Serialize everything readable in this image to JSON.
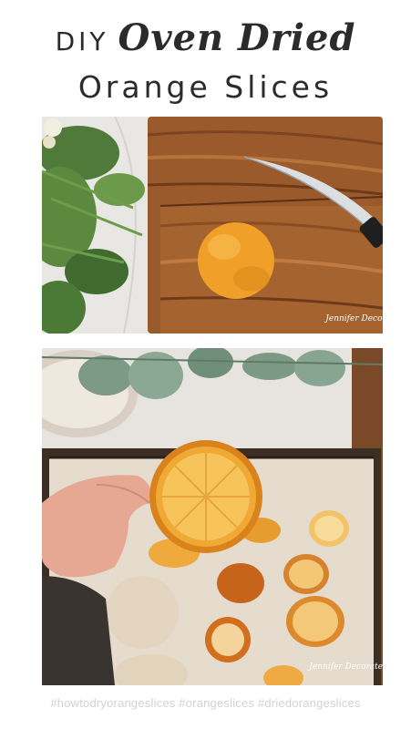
{
  "title": {
    "prefix": "DIY",
    "script": "Oven Dried",
    "main": "Orange Slices"
  },
  "photos": {
    "top": {
      "watermark": "Jennifer Decorates"
    },
    "bottom": {
      "watermark": "Jennifer Decorates"
    }
  },
  "hashtags": "#howtodryorangeslices #orangeslices #driedorangeslices"
}
